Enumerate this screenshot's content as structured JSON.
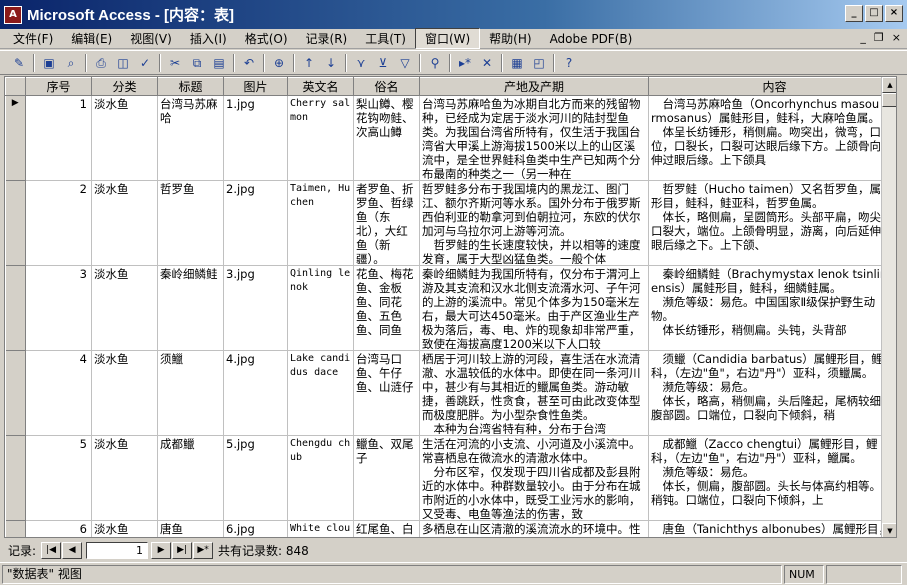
{
  "window": {
    "title": "Microsoft Access - [内容：表]",
    "icon_label": "A"
  },
  "menu": {
    "items": [
      "文件(F)",
      "编辑(E)",
      "视图(V)",
      "插入(I)",
      "格式(O)",
      "记录(R)",
      "工具(T)",
      "窗口(W)",
      "帮助(H)",
      "Adobe PDF(B)"
    ],
    "active": "窗口(W)"
  },
  "table": {
    "columns": [
      "序号",
      "分类",
      "标题",
      "图片",
      "英文名",
      "俗名",
      "产地及产期",
      "内容"
    ],
    "rows": [
      {
        "id": "1",
        "category": "淡水鱼",
        "title": "台湾马苏麻哈",
        "image": "1.jpg",
        "english": "Cherry salmon",
        "common": "梨山鳟、樱花钩吻鲑、次高山鳟",
        "origin": "台湾马苏麻哈鱼为冰期自北方而来的残留物种，已经成为定居于淡水河川的陆封型鱼类。为我国台湾省所特有，仅生活于我国台湾省大甲溪上游海拔1500米以上的山区溪流中，是全世界鲑科鱼类中生产已知两个分布最南的种类之一（另一种在",
        "content": "　台湾马苏麻哈鱼（Oncorhynchus masou formosanus）属鲑形目，鲑科，大麻哈鱼属。\n　体呈长纺锤形，稍侧扁。吻突出，微弯，口端位，口裂长，口裂可达眼后缘下方。上颌骨向后伸过眼后缘。上下颌具"
      },
      {
        "id": "2",
        "category": "淡水鱼",
        "title": "哲罗鱼",
        "image": "2.jpg",
        "english": "Taimen, Huchen",
        "common": "者罗鱼、折罗鱼、哲绿鱼（东北），大红鱼（新疆）。",
        "origin": "哲罗鲑多分布于我国境内的黑龙江、图门江、额尔齐斯河等水系。国外分布于俄罗斯西伯利亚的勒拿河到伯朝拉河，东欧的伏尔加河与乌拉尔河上游等河流。\n　哲罗鲑的生长速度较快，并以相等的速度发育，属于大型凶猛鱼类。一般个体",
        "content": "　哲罗鲑（Hucho taimen）又名哲罗鱼，属鲑形目，鲑科，鲑亚科，哲罗鱼属。\n　体长，略侧扁，呈圆筒形。头部平扁，吻尖，口裂大，端位。上颌骨明显，游离，向后延伸达眼后缘之下。上下颌、"
      },
      {
        "id": "3",
        "category": "淡水鱼",
        "title": "秦岭细鳞鲑",
        "image": "3.jpg",
        "english": "Qinling lenok",
        "common": "花鱼、梅花鱼、金板鱼、同花鱼、五色鱼、同鱼",
        "origin": "秦岭细鳞鲑为我国所特有，仅分布于渭河上游及其支流和汉水北侧支流湑水河、子午河的上游的溪流中。常见个体多为150毫米左右，最大可达450毫米。由于产区渔业生产极为落后，毒、电、炸的现象却非常严重，致使在海拔高度1200米以下人口较",
        "content": "　秦岭细鳞鲑（Brachymystax lenok tsinlingensis）属鲑形目，鲑科，细鳞鲑属。\n　濒危等级：易危。中国国家Ⅱ级保护野生动物。\n　体长纺锤形，稍侧扁。头钝，头背部"
      },
      {
        "id": "4",
        "category": "淡水鱼",
        "title": "须鱲",
        "image": "4.jpg",
        "english": "Lake candidus dace",
        "common": "台湾马口鱼、午仔鱼、山涟仔",
        "origin": "栖居于河川较上游的河段，喜生活在水流清澈、水温较低的水体中。即使在同一条河川中，甚少有与其相近的鱲属鱼类。游动敏捷，善跳跃，性贪食，甚至可由此改变体型而极度肥胖。为小型杂食性鱼类。\n　本种为台湾省特有种，分布于台湾",
        "content": "　须鱲（Candidia barbatus）属鲤形目，鲤科，（左边\"鱼\"，右边\"丹\"）亚科，须鱲属。\n　濒危等级：易危。\n　体长，略高，稍侧扁，头后隆起，尾柄较细，腹部圆。口端位，口裂向下倾斜，稍"
      },
      {
        "id": "5",
        "category": "淡水鱼",
        "title": "成都鱲",
        "image": "5.jpg",
        "english": "Chengdu chub",
        "common": "鱲鱼、双尾子",
        "origin": "生活在河流的小支流、小河道及小溪流中。常喜栖息在微流水的清澈水体中。\n　分布区窄，仅发现于四川省成都及彭县附近的水体中。种群数量较小。由于分布在城市附近的小水体中，既受工业污水的影响，又受毒、电鱼等渔法的伤害，致",
        "content": "　成都鱲（Zacco chengtui）属鲤形目，鲤科，（左边\"鱼\"，右边\"丹\"）亚科，鱲属。\n　濒危等级：易危。\n　体长，侧扁，腹部圆。头长与体高约相等。吻稍钝。口端位，口裂向下倾斜，上"
      },
      {
        "id": "6",
        "category": "淡水鱼",
        "title": "唐鱼",
        "image": "6.jpg",
        "english": "White cloud",
        "common": "红尾鱼、白云金丝鱼、",
        "origin": "多栖息在山区清澈的溪流流水的环境中。性活泼，温和，易分布于平地带，尚能耐",
        "content": "　唐鱼（Tanichthys albonubes）属鲤形目，鲤科，（左边\"鱼\"，右边"
      }
    ]
  },
  "navigation": {
    "record_label": "记录:",
    "current_record": "1",
    "total_label": "共有记录数: 848"
  },
  "status": {
    "view_text": "\"数据表\" 视图",
    "num_indicator": "NUM"
  }
}
